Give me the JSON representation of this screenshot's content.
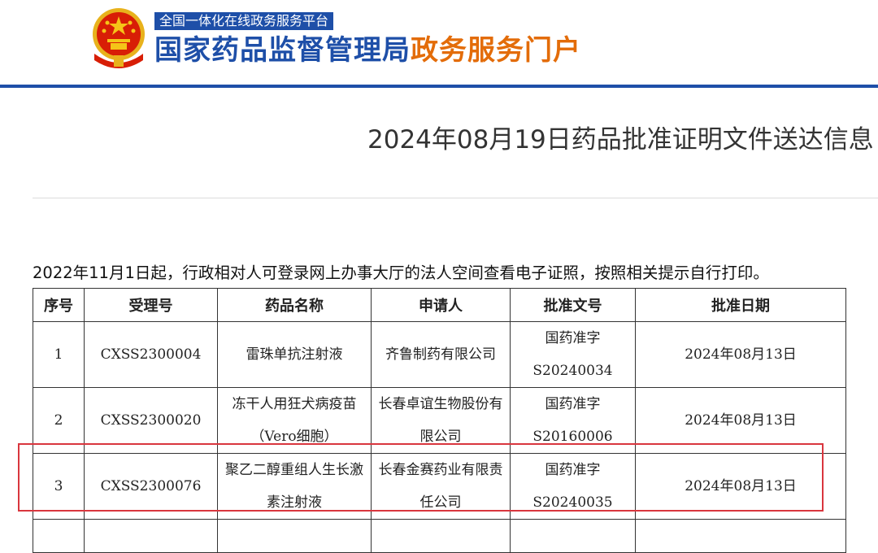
{
  "header": {
    "top_tag": "全国一体化在线政务服务平台",
    "title_main": "国家药品监督管理局",
    "title_sub": "政务服务门户",
    "colors": {
      "brand_blue": "#1e4fa8",
      "accent_orange": "#e36c09"
    }
  },
  "article": {
    "title": "2024年08月19日药品批准证明文件送达信息",
    "notice": "2022年11月1日起，行政相对人可登录网上办事大厅的法人空间查看电子证照，按照相关提示自行打印。"
  },
  "table": {
    "headers": [
      "序号",
      "受理号",
      "药品名称",
      "申请人",
      "批准文号",
      "批准日期"
    ],
    "rows": [
      {
        "no": "1",
        "acceptance_no": "CXSS2300004",
        "drug_name": "雷珠单抗注射液",
        "applicant": "齐鲁制药有限公司",
        "approval_no": "国药准字S20240034",
        "approval_date": "2024年08月13日"
      },
      {
        "no": "2",
        "acceptance_no": "CXSS2300020",
        "drug_name": "冻干人用狂犬病疫苗（Vero细胞）",
        "applicant": "长春卓谊生物股份有限公司",
        "approval_no": "国药准字S20160006",
        "approval_date": "2024年08月13日"
      },
      {
        "no": "3",
        "acceptance_no": "CXSS2300076",
        "drug_name": "聚乙二醇重组人生长激素注射液",
        "applicant": "长春金赛药业有限责任公司",
        "approval_no": "国药准字S20240035",
        "approval_date": "2024年08月13日"
      }
    ],
    "highlight_color": "#d9363e"
  }
}
